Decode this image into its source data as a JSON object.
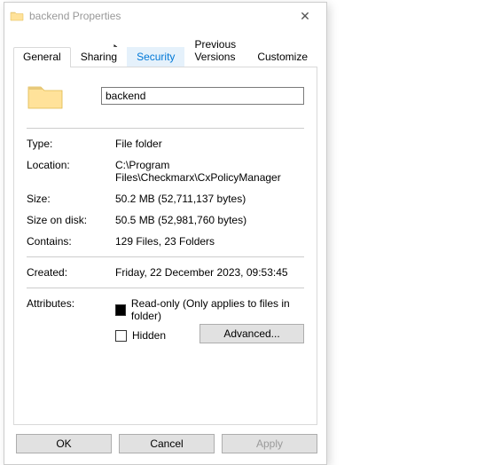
{
  "window": {
    "title": "backend Properties",
    "close_glyph": "✕"
  },
  "tabs": [
    {
      "label": "General"
    },
    {
      "label": "Sharing"
    },
    {
      "label": "Security"
    },
    {
      "label": "Previous Versions"
    },
    {
      "label": "Customize"
    }
  ],
  "name_value": "backend",
  "props": {
    "type_label": "Type:",
    "type_value": "File folder",
    "location_label": "Location:",
    "location_value": "C:\\Program Files\\Checkmarx\\CxPolicyManager",
    "size_label": "Size:",
    "size_value": "50.2 MB (52,711,137 bytes)",
    "sizeondisk_label": "Size on disk:",
    "sizeondisk_value": "50.5 MB (52,981,760 bytes)",
    "contains_label": "Contains:",
    "contains_value": "129 Files, 23 Folders",
    "created_label": "Created:",
    "created_value": "Friday, 22 December 2023, 09:53:45",
    "attrs_label": "Attributes:",
    "readonly_label": "Read-only (Only applies to files in folder)",
    "hidden_label": "Hidden",
    "advanced_label": "Advanced..."
  },
  "footer": {
    "ok": "OK",
    "cancel": "Cancel",
    "apply": "Apply"
  }
}
